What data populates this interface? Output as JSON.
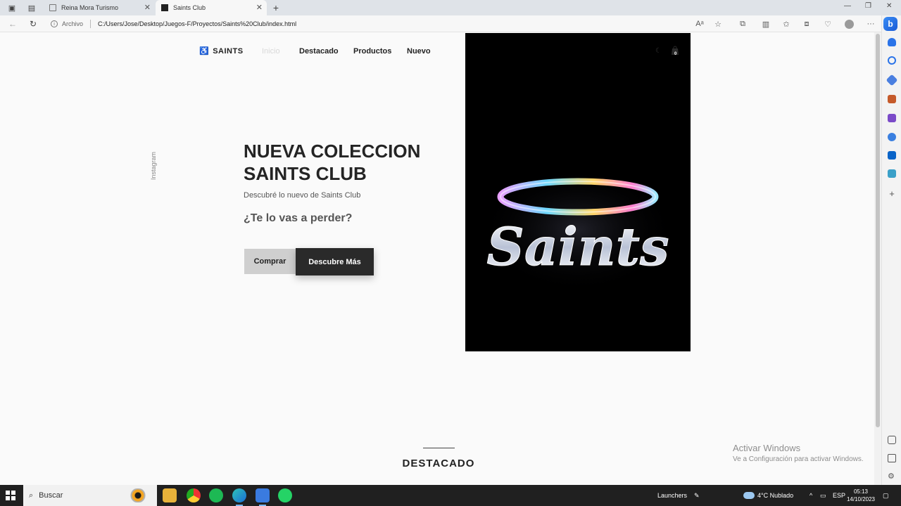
{
  "browser": {
    "tabs": [
      {
        "title": "Reina Mora Turismo",
        "active": false
      },
      {
        "title": "Saints Club",
        "active": true
      }
    ],
    "url_label": "Archivo",
    "url": "C:/Users/Jose/Desktop/Juegos-F/Proyectos/Saints%20Club/index.html"
  },
  "site": {
    "logo": "SAINTS",
    "nav": [
      "Inicio",
      "Destacado",
      "Productos",
      "Nuevo"
    ],
    "cart_count": "0",
    "instagram": "Instagram",
    "hero": {
      "title_line1": "NUEVA COLECCION",
      "title_line2": "SAINTS CLUB",
      "subtitle": "Descubré lo nuevo de Saints Club",
      "question": "¿Te lo vas a perder?",
      "btn_primary": "Comprar",
      "btn_secondary": "Descubre Más",
      "image_word": "Saints"
    },
    "section_title": "DESTACADO"
  },
  "watermark": {
    "line1": "Activar Windows",
    "line2": "Ve a Configuración para activar Windows."
  },
  "taskbar": {
    "search_placeholder": "Buscar",
    "launchers": "Launchers",
    "weather": "4°C  Nublado",
    "lang": "ESP",
    "time": "05:13",
    "date": "14/10/2023"
  },
  "colors": {
    "hero_image_bg": "#000000",
    "primary_button": "#2a2a2a",
    "secondary_button": "#cfcfcf"
  }
}
